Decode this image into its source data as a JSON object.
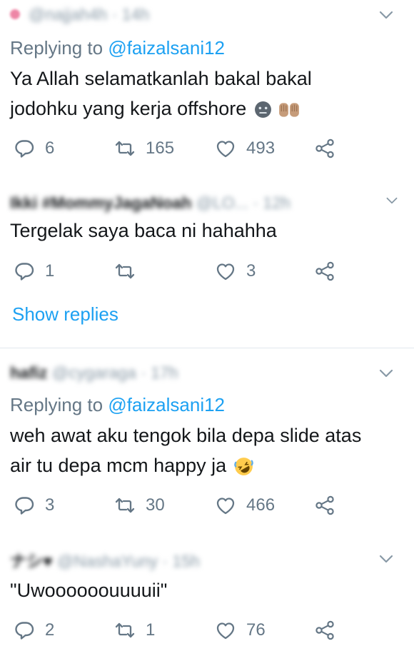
{
  "tweets": [
    {
      "author": "@najjah4h",
      "time": "14h",
      "replying_label": "Replying to",
      "replying_handle": "@faizalsani12",
      "line1": "Ya Allah selamatkanlah bakal bakal",
      "line2": "jodohku yang kerja offshore",
      "emoji": [
        "neutral-face",
        "praying-hands"
      ],
      "replies": "6",
      "retweets": "165",
      "likes": "493"
    },
    {
      "author": "Ikki #MommyJagaNoah",
      "handle": "@LO...",
      "time": "12h",
      "line1": "Tergelak saya baca ni hahahha",
      "replies": "1",
      "retweets": "",
      "likes": "3",
      "show_replies": "Show replies"
    },
    {
      "author": "hafiz",
      "handle": "@cygaraga",
      "time": "17h",
      "replying_label": "Replying to",
      "replying_handle": "@faizalsani12",
      "line1": "weh awat aku tengok bila depa slide atas",
      "line2": "air tu depa mcm happy ja",
      "emoji": [
        "rolling-laughing"
      ],
      "replies": "3",
      "retweets": "30",
      "likes": "466"
    },
    {
      "author": "ナシ♥",
      "handle": "@NashaYuny",
      "time": "15h",
      "line1": "\"Uwoooooouuuuii\"",
      "replies": "2",
      "retweets": "1",
      "likes": "76"
    }
  ],
  "colors": {
    "accent": "#1da1f2",
    "muted": "#657786",
    "text": "#14171a",
    "divider": "#e1e8ed"
  }
}
